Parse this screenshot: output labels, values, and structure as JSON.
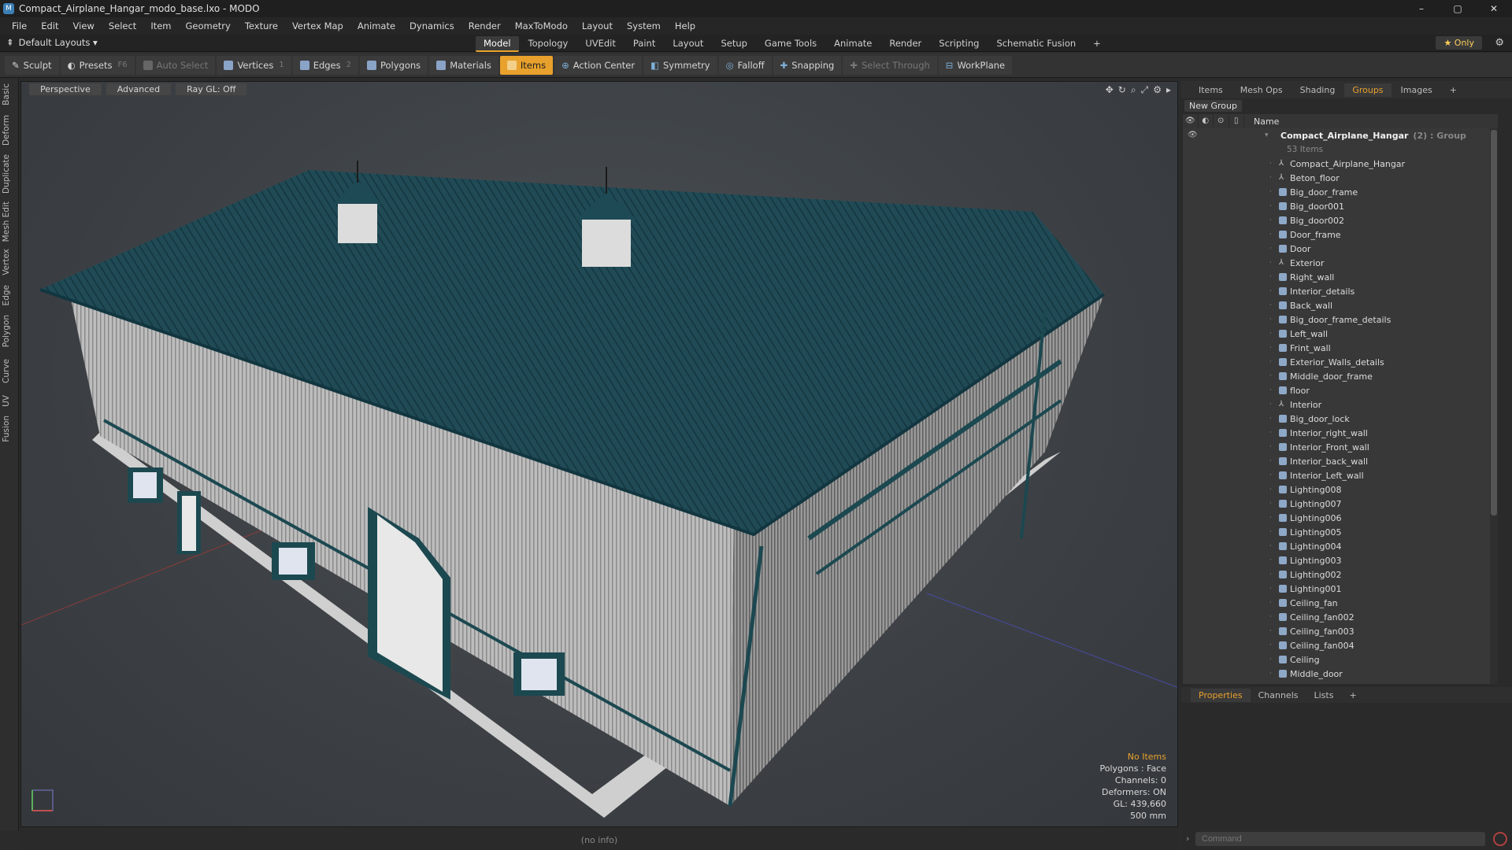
{
  "window": {
    "title": "Compact_Airplane_Hangar_modo_base.lxo - MODO",
    "controls": [
      "–",
      "▢",
      "✕"
    ]
  },
  "menu": [
    "File",
    "Edit",
    "View",
    "Select",
    "Item",
    "Geometry",
    "Texture",
    "Vertex Map",
    "Animate",
    "Dynamics",
    "Render",
    "MaxToModo",
    "Layout",
    "System",
    "Help"
  ],
  "layouts": {
    "default": "Default Layouts ▾",
    "tabs": [
      "Model",
      "Topology",
      "UVEdit",
      "Paint",
      "Layout",
      "Setup",
      "Game Tools",
      "Animate",
      "Render",
      "Scripting",
      "Schematic Fusion",
      "+"
    ],
    "active_tab": "Model",
    "only": "★ Only"
  },
  "toolbar": {
    "sculpt": "Sculpt",
    "presets": "Presets",
    "presets_key": "F6",
    "auto_select": "Auto Select",
    "vertices": "Vertices",
    "vertices_key": "1",
    "edges": "Edges",
    "edges_key": "2",
    "polygons": "Polygons",
    "materials": "Materials",
    "items": "Items",
    "action_center": "Action Center",
    "symmetry": "Symmetry",
    "falloff": "Falloff",
    "snapping": "Snapping",
    "select_through": "Select Through",
    "workplane": "WorkPlane"
  },
  "left_tabs": [
    "Basic",
    "Deform",
    "Duplicate",
    "Mesh Edit",
    "Vertex",
    "Edge",
    "Polygon",
    "Curve",
    "UV",
    "Fusion"
  ],
  "viewport": {
    "view": "Perspective",
    "shading": "Advanced",
    "raygl": "Ray GL: Off",
    "info": {
      "selection": "No Items",
      "polygons": "Polygons : Face",
      "channels": "Channels: 0",
      "deformers": "Deformers: ON",
      "gl": "GL: 439,660",
      "scale": "500 mm"
    }
  },
  "status": "(no info)",
  "right_panel": {
    "tabs": [
      "Items",
      "Mesh Ops",
      "Shading",
      "Groups",
      "Images",
      "+"
    ],
    "active_tab": "Groups",
    "new_group": "New Group",
    "column_name": "Name",
    "root": {
      "name": "Compact_Airplane_Hangar",
      "meta": "(2) : Group",
      "count": "53 Items"
    },
    "items": [
      {
        "name": "Compact_Airplane_Hangar",
        "type": "locator"
      },
      {
        "name": "Beton_floor",
        "type": "locator"
      },
      {
        "name": "Big_door_frame",
        "type": "mesh"
      },
      {
        "name": "Big_door001",
        "type": "mesh"
      },
      {
        "name": "Big_door002",
        "type": "mesh"
      },
      {
        "name": "Door_frame",
        "type": "mesh"
      },
      {
        "name": "Door",
        "type": "mesh"
      },
      {
        "name": "Exterior",
        "type": "locator"
      },
      {
        "name": "Right_wall",
        "type": "mesh"
      },
      {
        "name": "Interior_details",
        "type": "mesh"
      },
      {
        "name": "Back_wall",
        "type": "mesh"
      },
      {
        "name": "Big_door_frame_details",
        "type": "mesh"
      },
      {
        "name": "Left_wall",
        "type": "mesh"
      },
      {
        "name": "Frint_wall",
        "type": "mesh"
      },
      {
        "name": "Exterior_Walls_details",
        "type": "mesh"
      },
      {
        "name": "Middle_door_frame",
        "type": "mesh"
      },
      {
        "name": "floor",
        "type": "mesh"
      },
      {
        "name": "Interior",
        "type": "locator"
      },
      {
        "name": "Big_door_lock",
        "type": "mesh"
      },
      {
        "name": "Interior_right_wall",
        "type": "mesh"
      },
      {
        "name": "Interior_Front_wall",
        "type": "mesh"
      },
      {
        "name": "Interior_back_wall",
        "type": "mesh"
      },
      {
        "name": "Interior_Left_wall",
        "type": "mesh"
      },
      {
        "name": "Lighting008",
        "type": "mesh"
      },
      {
        "name": "Lighting007",
        "type": "mesh"
      },
      {
        "name": "Lighting006",
        "type": "mesh"
      },
      {
        "name": "Lighting005",
        "type": "mesh"
      },
      {
        "name": "Lighting004",
        "type": "mesh"
      },
      {
        "name": "Lighting003",
        "type": "mesh"
      },
      {
        "name": "Lighting002",
        "type": "mesh"
      },
      {
        "name": "Lighting001",
        "type": "mesh"
      },
      {
        "name": "Ceiling_fan",
        "type": "mesh"
      },
      {
        "name": "Ceiling_fan002",
        "type": "mesh"
      },
      {
        "name": "Ceiling_fan003",
        "type": "mesh"
      },
      {
        "name": "Ceiling_fan004",
        "type": "mesh"
      },
      {
        "name": "Ceiling",
        "type": "mesh"
      },
      {
        "name": "Middle_door",
        "type": "mesh"
      }
    ],
    "props_tabs": [
      "Properties",
      "Channels",
      "Lists",
      "+"
    ],
    "props_active": "Properties",
    "command_placeholder": "Command"
  },
  "colors": {
    "accent": "#e8a12c",
    "roof": "#1e4a55",
    "wall": "#b8b8b8",
    "trim": "#1c4850"
  }
}
